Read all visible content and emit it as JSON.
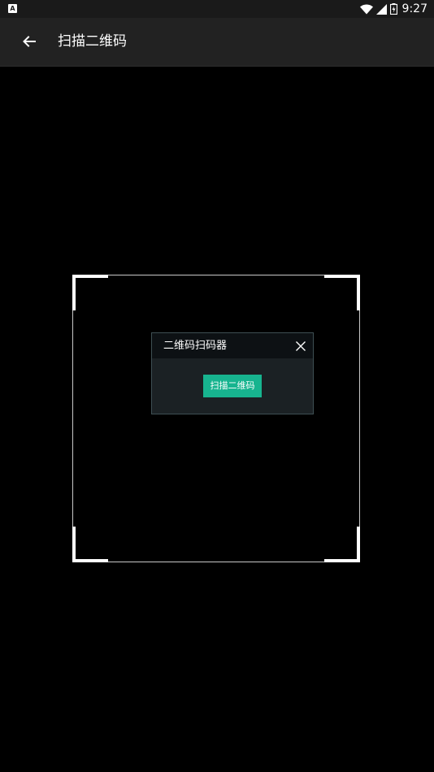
{
  "status_bar": {
    "time": "9:27",
    "left_icon": "A",
    "icons": [
      "wifi-icon",
      "signal-icon",
      "battery-icon"
    ]
  },
  "toolbar": {
    "back_icon": "arrow-left-icon",
    "title": "扫描二维码"
  },
  "dialog": {
    "title": "二维码扫码器",
    "close_icon": "close-icon",
    "scan_button_label": "扫描二维码",
    "accent_color": "#17b48f"
  }
}
